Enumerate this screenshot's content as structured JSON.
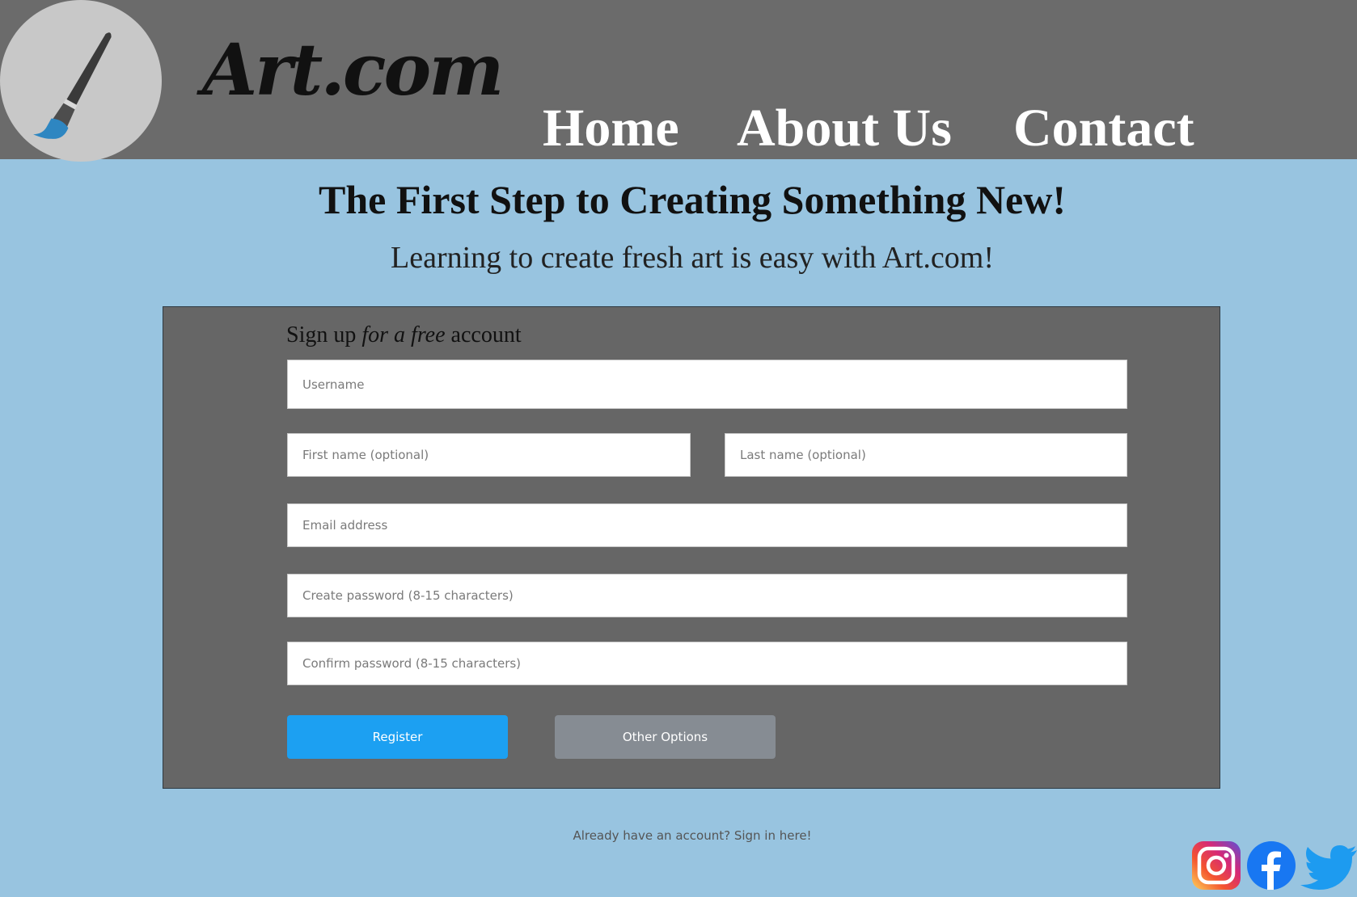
{
  "header": {
    "brand": "Art.com",
    "nav": [
      "Home",
      "About Us",
      "Contact"
    ]
  },
  "hero": {
    "title": "The First Step to Creating Something New!",
    "subtitle": "Learning to create fresh art is easy with Art.com!"
  },
  "form": {
    "title_prefix": "Sign up ",
    "title_emphasis": "for a free",
    "title_suffix": " account",
    "username_placeholder": "Username",
    "first_name_placeholder": "First name (optional)",
    "last_name_placeholder": "Last name (optional)",
    "email_placeholder": "Email address",
    "password_placeholder": "Create password (8-15 characters)",
    "confirm_placeholder": "Confirm password (8-15 characters)",
    "register_label": "Register",
    "other_label": "Other Options"
  },
  "footer": {
    "signin_text": "Already have an account? Sign in here!"
  },
  "social": [
    "instagram-icon",
    "facebook-icon",
    "twitter-icon"
  ],
  "colors": {
    "header_bg": "#6b6b6b",
    "page_bg": "#98c4e0",
    "panel_bg": "#666666",
    "register_button": "#1ca0f2",
    "other_button": "#868c93"
  }
}
